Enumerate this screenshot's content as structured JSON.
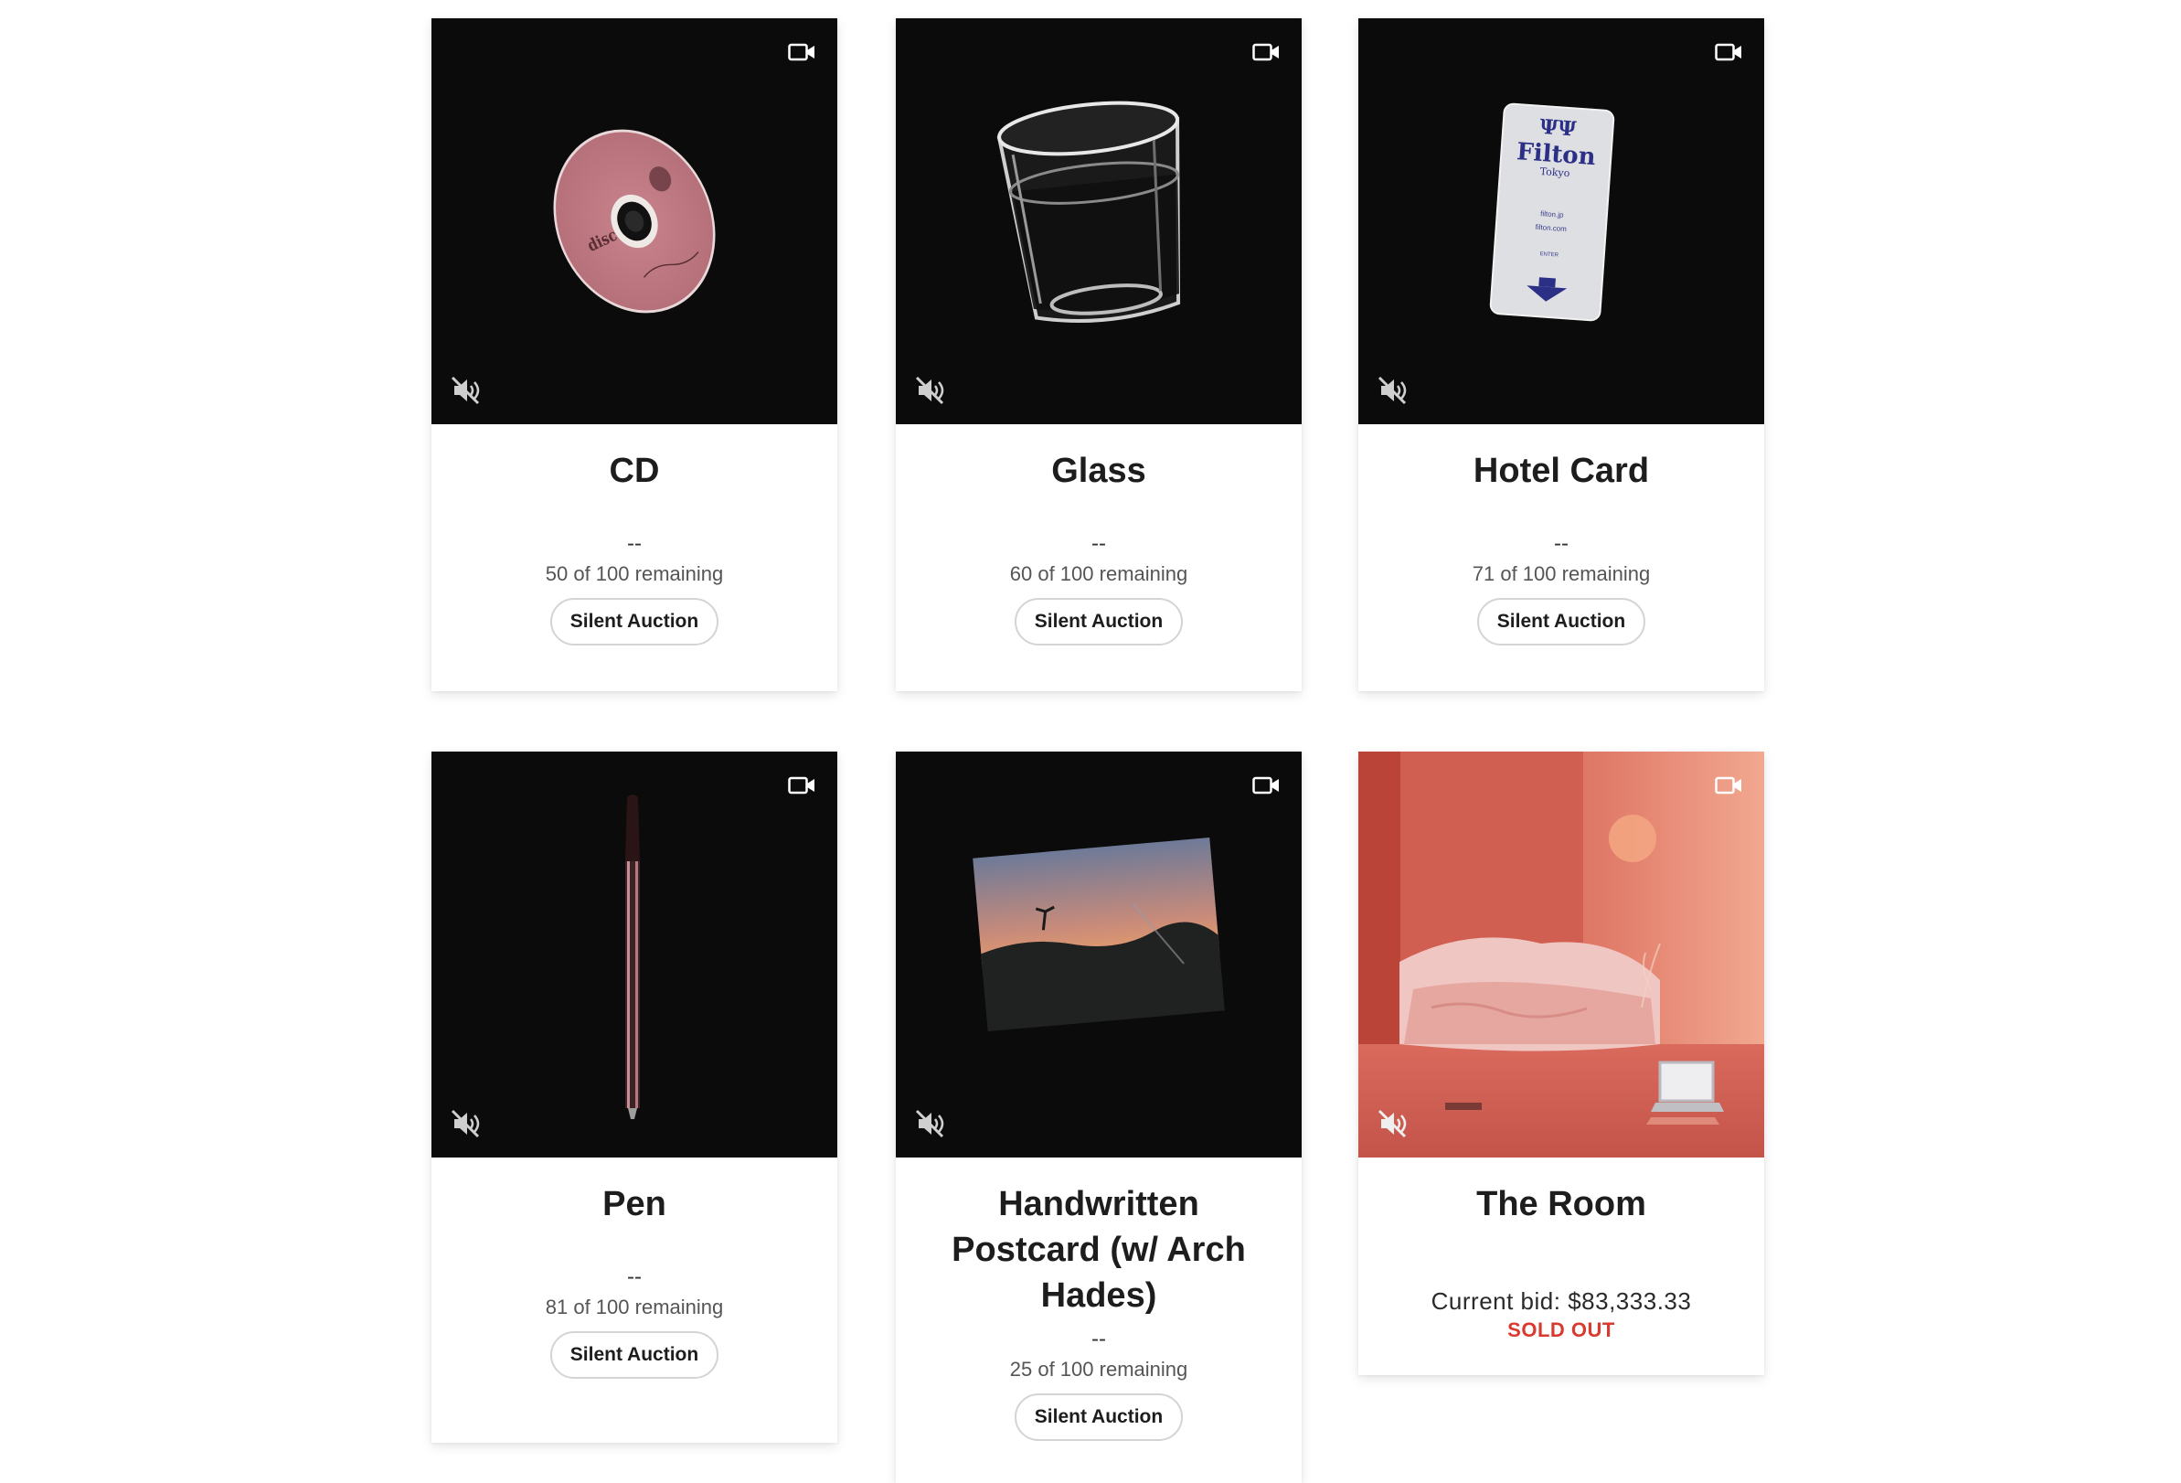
{
  "items": [
    {
      "title": "CD",
      "price": "--",
      "remaining": "50 of 100 remaining",
      "button": "Silent Auction"
    },
    {
      "title": "Glass",
      "price": "--",
      "remaining": "60 of 100 remaining",
      "button": "Silent Auction"
    },
    {
      "title": "Hotel Card",
      "price": "--",
      "remaining": "71 of 100 remaining",
      "button": "Silent Auction",
      "card_text": {
        "brand": "Filton",
        "city": "Tokyo",
        "line1": "filton.jp",
        "line2": "filton.com",
        "line3": "ENTER"
      }
    },
    {
      "title": "Pen",
      "price": "--",
      "remaining": "81 of 100 remaining",
      "button": "Silent Auction"
    },
    {
      "title": "Handwritten Postcard (w/ Arch Hades)",
      "price": "--",
      "remaining": "25 of 100 remaining",
      "button": "Silent Auction"
    },
    {
      "title": "The Room",
      "bid": "Current bid: $83,333.33",
      "status": "SOLD OUT"
    }
  ],
  "icons": {
    "video": "video-camera-icon",
    "mute": "speaker-muted-icon"
  },
  "colors": {
    "media_bg": "#0b0b0b",
    "sold_out": "#d93a2f",
    "room_bg": "#d9655a"
  }
}
